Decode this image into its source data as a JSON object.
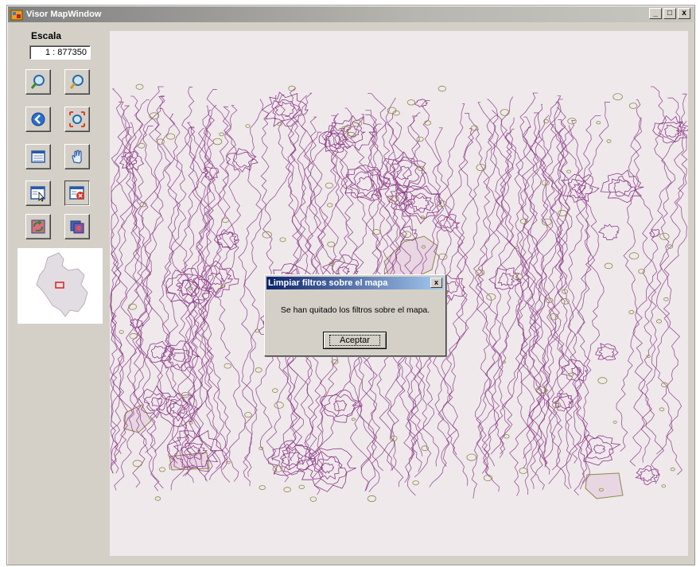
{
  "window": {
    "title": "Visor MapWindow",
    "minimize_glyph": "_",
    "maximize_glyph": "□",
    "close_glyph": "x"
  },
  "sidebar": {
    "scale_label": "Escala",
    "scale_value": "1 : 877350",
    "tools": [
      {
        "icon": "zoom-in-icon"
      },
      {
        "icon": "zoom-out-icon"
      },
      {
        "icon": "back-arrow-icon"
      },
      {
        "icon": "zoom-extent-icon"
      },
      {
        "icon": "layer-list-icon"
      },
      {
        "icon": "pan-hand-icon"
      },
      {
        "icon": "apply-filter-icon"
      },
      {
        "icon": "clear-filter-icon"
      },
      {
        "icon": "refresh-map-icon"
      },
      {
        "icon": "export-map-icon"
      }
    ],
    "overview_icon": "colombia-overview-map"
  },
  "dialog": {
    "title": "Limpiar filtros sobre el mapa",
    "close_glyph": "x",
    "message": "Se han quitado los filtros sobre el mapa.",
    "ok_label": "Aceptar"
  },
  "colors": {
    "contour": "#8b3a86",
    "polygon_fill": "#e8d6e2",
    "polygon_stroke": "#8d8a45",
    "map_background": "#efe9ec",
    "dialog_title": "#0a246a"
  }
}
